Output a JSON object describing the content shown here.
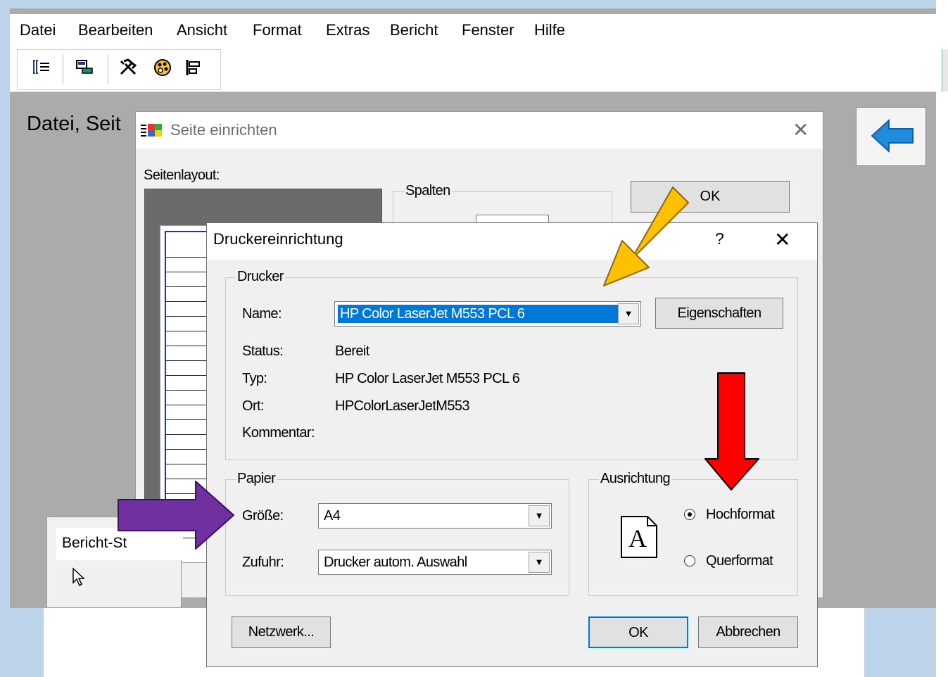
{
  "menu": [
    "Datei",
    "Bearbeiten",
    "Ansicht",
    "Format",
    "Extras",
    "Bericht",
    "Fenster",
    "Hilfe"
  ],
  "toolbar": {
    "icons": [
      "field-list-icon",
      "properties-icon",
      "toolbox-icon",
      "palette-icon",
      "alignment-icon"
    ]
  },
  "page": {
    "heading": "Datei, Seit"
  },
  "seite_dialog": {
    "title": "Seite einrichten",
    "layout_label": "Seitenlayout:",
    "columns_group": "Spalten",
    "ok_label": "OK"
  },
  "bericht_palette": {
    "title": "Bericht-St"
  },
  "printer_dialog": {
    "title": "Druckereinrichtung",
    "help_label": "?",
    "close_label": "X",
    "printer_group": "Drucker",
    "name_label": "Name:",
    "name_value": "HP Color LaserJet M553 PCL 6",
    "properties_button": "Eigenschaften",
    "status_label": "Status:",
    "status_value": "Bereit",
    "type_label": "Typ:",
    "type_value": "HP Color LaserJet M553 PCL 6",
    "location_label": "Ort:",
    "location_value": "HPColorLaserJetM553",
    "comment_label": "Kommentar:",
    "comment_value": "",
    "paper_group": "Papier",
    "size_label": "Größe:",
    "size_value": "A4",
    "source_label": "Zufuhr:",
    "source_value": "Drucker autom. Auswahl",
    "orientation_group": "Ausrichtung",
    "orientation_icon_letter": "A",
    "portrait_label": "Hochformat",
    "landscape_label": "Querformat",
    "selected_orientation": "Hochformat",
    "network_button": "Netzwerk...",
    "ok_button": "OK",
    "cancel_button": "Abbrechen"
  },
  "annotations": {
    "orange_arrow_color": "#ffc000",
    "red_arrow_color": "#ff0000",
    "purple_arrow_color": "#7030a0",
    "back_arrow_color": "#1e8bdc"
  }
}
